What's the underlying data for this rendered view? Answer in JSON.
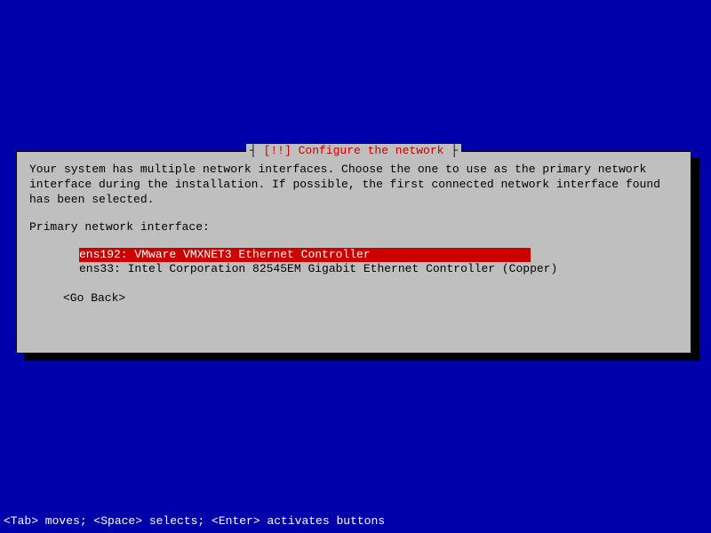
{
  "dialog": {
    "title_bracket_open": "┤ ",
    "title_alert": "[!!]",
    "title_text": " Configure the network",
    "title_bracket_close": " ├",
    "description": "Your system has multiple network interfaces. Choose the one to use as the primary network interface during the installation. If possible, the first connected network interface found has been selected.",
    "prompt": "Primary network interface:",
    "interfaces": [
      "ens192: VMware VMXNET3 Ethernet Controller",
      "ens33: Intel Corporation 82545EM Gigabit Ethernet Controller (Copper)"
    ],
    "go_back": "<Go Back>"
  },
  "help_bar": "<Tab> moves; <Space> selects; <Enter> activates buttons"
}
